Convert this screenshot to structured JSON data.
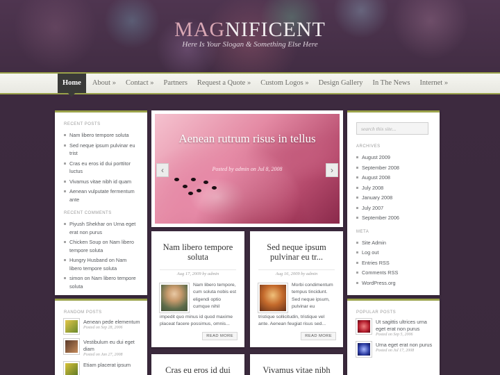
{
  "site": {
    "logo_first": "MAG",
    "logo_rest": "NIFICENT",
    "slogan": "Here Is Your Slogan & Something Else Here"
  },
  "nav": {
    "items": [
      {
        "label": "Home"
      },
      {
        "label": "About »"
      },
      {
        "label": "Contact »"
      },
      {
        "label": "Partners"
      },
      {
        "label": "Request a Quote »"
      },
      {
        "label": "Custom Logos »"
      },
      {
        "label": "Design Gallery"
      },
      {
        "label": "In The News"
      },
      {
        "label": "Internet »"
      }
    ]
  },
  "left_sidebar": {
    "recent_posts_title": "RECENT POSTS",
    "recent_posts": [
      "Nam libero tempore soluta",
      "Sed neque ipsum pulvinar eu trist",
      "Cras eu eros id dui porttitor luctus",
      "Vivamus vitae nibh id quam",
      "Aenean vulputate fermentum ante"
    ],
    "recent_comments_title": "RECENT COMMENTS",
    "recent_comments": [
      "Piyush Shekhar on Urna eget erat non purus",
      "Chicken Soup on Nam libero tempore soluta",
      "Hungry Husband on Nam libero tempore soluta",
      "simon on Nam libero tempore soluta"
    ],
    "random_posts_title": "RANDOM POSTS",
    "random_posts": [
      {
        "title": "Aenean pede elementum",
        "date": "Posted on Sep 28, 2006"
      },
      {
        "title": "Vestibulum eu dui eget diam",
        "date": "Posted on Jan 27, 2008"
      },
      {
        "title": "Etiam placerat ipsum",
        "date": ""
      }
    ]
  },
  "featured": {
    "title": "Aenean rutrum risus in tellus",
    "meta": "Posted by admin on Jul 8, 2008",
    "prev_icon": "‹",
    "next_icon": "›"
  },
  "posts": [
    {
      "title": "Nam libero tempore soluta",
      "meta": "Aug 17, 2009 by admin",
      "excerpt_side": "Nam libero tempore, cum soluta nobis est eligendi optio cumque nihil",
      "excerpt_full": "impedit quo minus id quod maxime placeat facere possimus, omnis...",
      "read_more": "READ MORE"
    },
    {
      "title": "Sed neque ipsum pulvinar eu tr...",
      "meta": "Aug 16, 2009 by admin",
      "excerpt_side": "Morbi condimentum tempus tincidunt. Sed neque ipsum, pulvinar eu",
      "excerpt_full": "tristique sollicitudin, tristique vel ante. Aenean feugiat risus sed...",
      "read_more": "READ MORE"
    },
    {
      "title": "Cras eu eros id dui"
    },
    {
      "title": "Vivamus vitae nibh"
    }
  ],
  "right_sidebar": {
    "search_placeholder": "search this site...",
    "archives_title": "ARCHIVES",
    "archives": [
      "August 2009",
      "September 2008",
      "August 2008",
      "July 2008",
      "January 2008",
      "July 2007",
      "September 2006"
    ],
    "meta_title": "META",
    "meta": [
      "Site Admin",
      "Log out",
      "Entries RSS",
      "Comments RSS",
      "WordPress.org"
    ],
    "popular_title": "POPULAR POSTS",
    "popular_posts": [
      {
        "title": "Ut sagittis ultrices urna eget erat non purus",
        "date": "Posted on Sep 5, 2006"
      },
      {
        "title": "Urna eget erat non purus",
        "date": "Posted on Jul 17, 2008"
      }
    ]
  },
  "colors": {
    "accent": "#9aa24a",
    "background": "#3f2a40",
    "logo_accent": "#d9a7b4"
  }
}
